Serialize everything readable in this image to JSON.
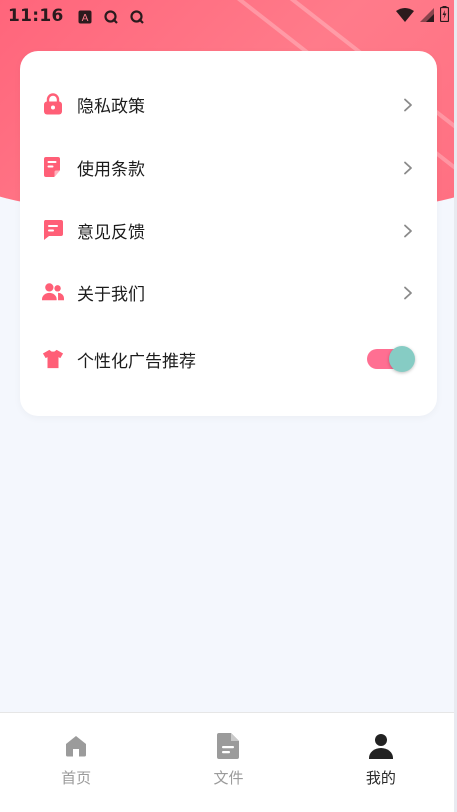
{
  "status_bar": {
    "time": "11:16",
    "left_icons": [
      "keyboard-a-icon",
      "search-q-icon",
      "search-q-icon"
    ],
    "right_icons": [
      "wifi-icon",
      "signal-icon",
      "battery-charging-icon"
    ]
  },
  "settings": {
    "items": [
      {
        "label": "隐私政策",
        "icon": "lock-icon"
      },
      {
        "label": "使用条款",
        "icon": "document-icon"
      },
      {
        "label": "意见反馈",
        "icon": "message-icon"
      },
      {
        "label": "关于我们",
        "icon": "users-icon"
      }
    ],
    "toggle_item": {
      "label": "个性化广告推荐",
      "icon": "shirt-icon",
      "enabled": true
    }
  },
  "tabbar": {
    "tabs": [
      {
        "label": "首页",
        "icon": "home-icon"
      },
      {
        "label": "文件",
        "icon": "file-icon"
      },
      {
        "label": "我的",
        "icon": "person-icon",
        "active": true
      }
    ]
  },
  "colors": {
    "accent": "#ff5f77",
    "toggle_track": "#ff6f92",
    "toggle_knob": "#86ccc4",
    "background": "#f4f7fd"
  }
}
